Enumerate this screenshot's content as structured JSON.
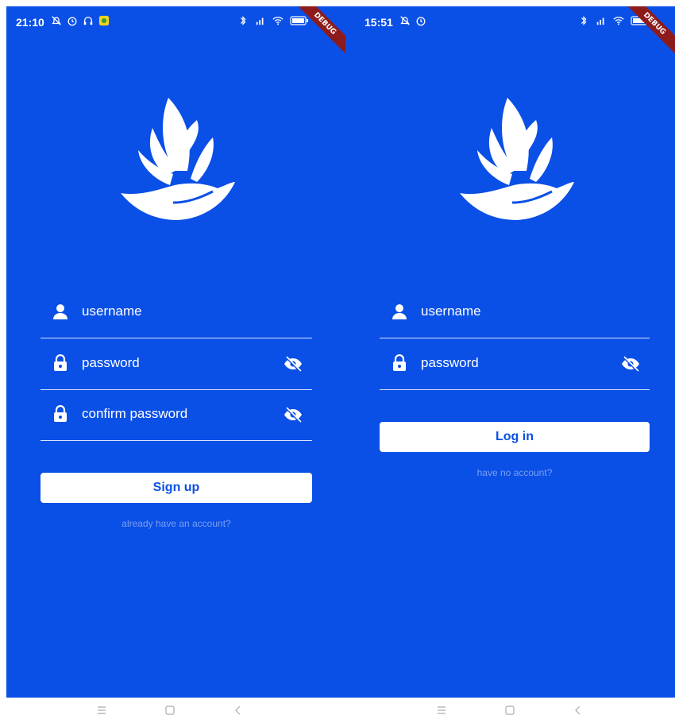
{
  "signup": {
    "status_time": "21:10",
    "debug": "DEBUG",
    "fields": {
      "username": "username",
      "password": "password",
      "confirm": "confirm password"
    },
    "button": "Sign up",
    "link": "already have an account?"
  },
  "login": {
    "status_time": "15:51",
    "debug": "DEBUG",
    "fields": {
      "username": "username",
      "password": "password"
    },
    "button": "Log in",
    "link": "have no account?"
  },
  "icons": {
    "logo": "hand-with-antlers-logo-icon",
    "user": "person-icon",
    "lock": "lock-icon",
    "visibility": "eye-off-icon",
    "nav": [
      "menu-icon",
      "home-icon",
      "back-icon"
    ]
  },
  "colors": {
    "background": "#0a4fe6",
    "button": "#ffffff",
    "button_text": "#0a4fe6"
  }
}
